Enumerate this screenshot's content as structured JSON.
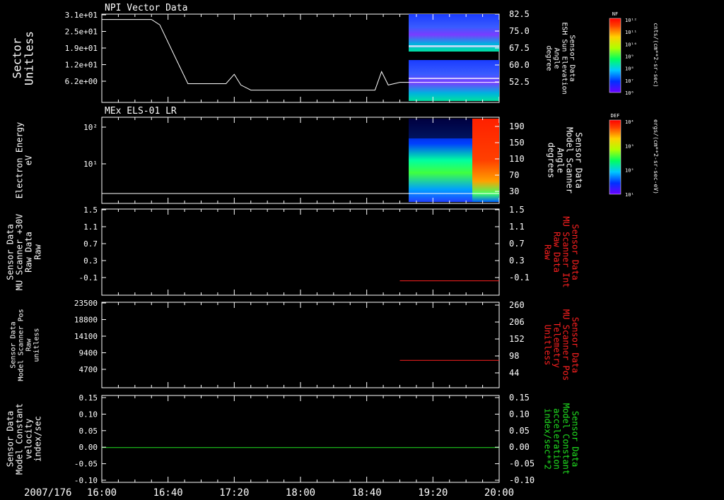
{
  "date_label": "2007/176",
  "time_ticks": [
    "16:00",
    "16:40",
    "17:20",
    "18:00",
    "18:40",
    "19:20",
    "20:00"
  ],
  "colors": {
    "axis": "#ffffff",
    "red": "#ff2020",
    "green": "#20e020"
  },
  "panels": [
    {
      "title": "NPI Vector Data",
      "left_label": [
        "Sector",
        "Unitless"
      ],
      "left_ticks": [
        "3.1e+01",
        "2.5e+01",
        "1.9e+01",
        "1.2e+01",
        "6.2e+00"
      ],
      "right_label": [
        "Sensor Data",
        "ESH Sun Elevation",
        "Angle",
        "degree"
      ],
      "right_ticks": [
        "82.5",
        "75.0",
        "67.5",
        "60.0",
        "52.5"
      ]
    },
    {
      "title": "MEx ELS-01 LR",
      "left_label": [
        "Electron Energy",
        "eV"
      ],
      "left_ticks": [
        "10²",
        "10¹"
      ],
      "right_label": [
        "Sensor Data",
        "Model Scanner",
        "Angle",
        "degrees"
      ],
      "right_ticks": [
        "190",
        "150",
        "110",
        "70",
        "30"
      ]
    },
    {
      "left_label": [
        "Sensor Data",
        "MU Scanner +30V",
        "Raw Data",
        "Raw"
      ],
      "left_ticks": [
        "1.5",
        "1.1",
        "0.7",
        "0.3",
        "-0.1"
      ],
      "right_label": [
        "Sensor Data",
        "MU Scanner Int",
        "Raw Data",
        "Raw"
      ],
      "right_ticks": [
        "1.5",
        "1.1",
        "0.7",
        "0.3",
        "-0.1"
      ]
    },
    {
      "left_label": [
        "Sensor Data",
        "Model Scanner Pos",
        "Raw",
        "unitless"
      ],
      "left_ticks": [
        "23500",
        "18800",
        "14100",
        "9400",
        "4700"
      ],
      "right_label": [
        "Sensor Data",
        "MU Scanner Pos",
        "Telemetry",
        "Unitless"
      ],
      "right_ticks": [
        "260",
        "206",
        "152",
        "98",
        "44"
      ]
    },
    {
      "left_label": [
        "Sensor Data",
        "Model Constant",
        "velocity",
        "index/sec"
      ],
      "left_ticks": [
        "0.15",
        "0.10",
        "0.05",
        "0.00",
        "-0.05",
        "-0.10"
      ],
      "right_label": [
        "Sensor Data",
        "Model Constant",
        "acceleration",
        "index/sec**2"
      ],
      "right_ticks": [
        "0.15",
        "0.10",
        "0.05",
        "0.00",
        "-0.05",
        "-0.10"
      ]
    }
  ],
  "colorbars": [
    {
      "name": "NF",
      "unit": "cnts/(cm**2-sr-sec)",
      "ticks": [
        "10¹²",
        "10¹¹",
        "10¹⁰",
        "10⁹",
        "10⁸",
        "10⁷",
        "10⁶"
      ]
    },
    {
      "name": "DEF",
      "unit": "ergs/(cm**2-sr-sec-eV)",
      "ticks": [
        "10⁴",
        "10³",
        "10²",
        "10¹"
      ]
    }
  ],
  "chart_data": {
    "type": "line",
    "x_range": [
      "16:00",
      "20:00"
    ],
    "sector_trace": {
      "ylim": [
        0,
        33
      ],
      "x": [
        "16:00",
        "16:30",
        "16:35",
        "16:45",
        "16:52",
        "17:15",
        "17:20",
        "17:24",
        "17:30",
        "18:45",
        "18:49",
        "18:53",
        "19:00",
        "20:00"
      ],
      "y": [
        31,
        31,
        29,
        16,
        7,
        7,
        10.5,
        6.5,
        4.6,
        4.6,
        11.5,
        6.5,
        7.5,
        7.5
      ]
    },
    "electron_energy_threshold": {
      "x": [
        "16:00",
        "20:00"
      ],
      "y_eV": [
        2.2,
        2.2
      ]
    },
    "scanner_int_raw": {
      "x": [
        "19:00",
        "20:00"
      ],
      "y": [
        0.0,
        0.0
      ],
      "ylim": [
        -0.3,
        1.5
      ]
    },
    "scanner_pos_telemetry": {
      "x": [
        "19:00",
        "20:00"
      ],
      "y": [
        90,
        90
      ],
      "ylim": [
        10,
        260
      ]
    },
    "constant_velocity": {
      "x": [
        "16:00",
        "20:00"
      ],
      "y": [
        0.0,
        0.0
      ],
      "ylim": [
        -0.1,
        0.15
      ]
    }
  }
}
